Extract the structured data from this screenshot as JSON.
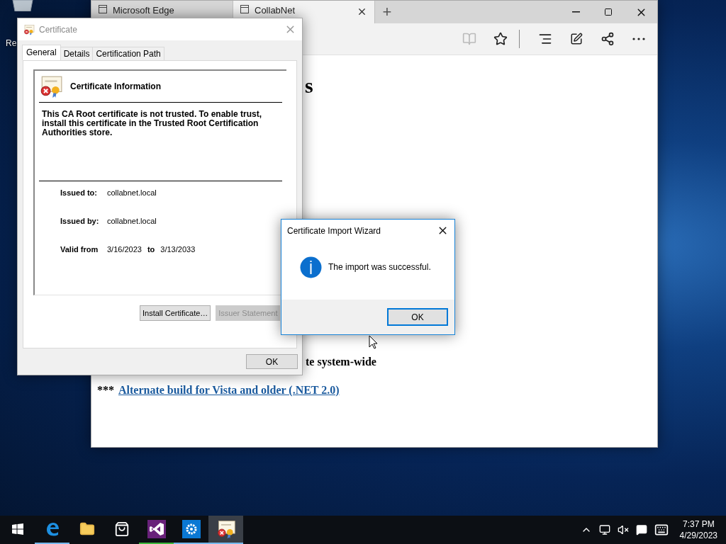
{
  "desktop": {
    "icons": [
      {
        "label": "Re"
      }
    ]
  },
  "browser": {
    "tabs": [
      {
        "title": "Microsoft Edge",
        "selected": false
      },
      {
        "title": "CollabNet",
        "selected": true
      }
    ],
    "new_tab": "+",
    "reading_view": {
      "disabled": true
    },
    "content": {
      "heading_fragment": "s",
      "line_fragment": "te system-wide",
      "prefix": "***",
      "link": "Alternate build for Vista and older (.NET 2.0)"
    }
  },
  "certificate_dialog": {
    "title": "Certificate",
    "active": false,
    "tabs": [
      {
        "label": "General",
        "selected": true
      },
      {
        "label": "Details",
        "selected": false
      },
      {
        "label": "Certification Path",
        "selected": false
      }
    ],
    "info_title": "Certificate Information",
    "message": "This CA Root certificate is not trusted. To enable trust, install this certificate in the Trusted Root Certification Authorities store.",
    "fields": [
      {
        "label": "Issued to:",
        "value": "collabnet.local"
      },
      {
        "label": "Issued by:",
        "value": "collabnet.local"
      }
    ],
    "validity": {
      "label": "Valid from",
      "from": "3/16/2023",
      "to_label": "to",
      "to": "3/13/2033"
    },
    "buttons": [
      {
        "label": "Install Certificate…",
        "disabled": false
      },
      {
        "label": "Issuer Statement",
        "disabled": true
      }
    ],
    "ok": "OK"
  },
  "wizard": {
    "title": "Certificate Import Wizard",
    "active": true,
    "message": "The import was successful.",
    "ok": "OK"
  },
  "taskbar": {
    "apps": [
      {
        "kind": "start",
        "running": false,
        "active": false
      },
      {
        "kind": "edge",
        "running": true,
        "active": false
      },
      {
        "kind": "explorer",
        "running": false,
        "active": false
      },
      {
        "kind": "store",
        "running": false,
        "active": false
      },
      {
        "kind": "studio",
        "running": true,
        "active": false
      },
      {
        "kind": "settings",
        "running": true,
        "active": false
      },
      {
        "kind": "certificate",
        "running": true,
        "active": true
      }
    ],
    "clock": {
      "time": "7:37 PM",
      "date": "4/29/2023"
    }
  }
}
